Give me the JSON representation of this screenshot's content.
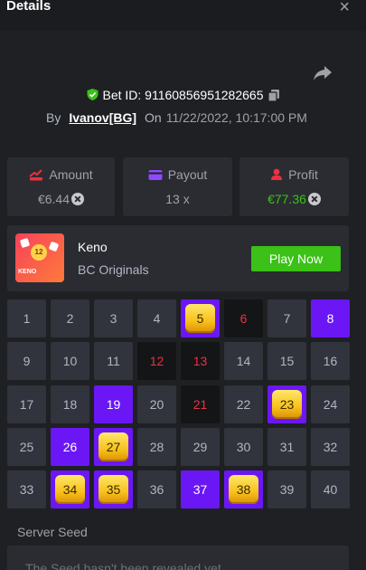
{
  "header": {
    "title": "Details",
    "close_icon": "×"
  },
  "bet": {
    "id_text": "Bet ID: 91160856951282665",
    "by_label": "By",
    "user": "Ivanov[BG]",
    "on_label": "On",
    "datetime": "11/22/2022, 10:17:00 PM"
  },
  "stats": {
    "amount": {
      "label": "Amount",
      "value": "€6.44"
    },
    "payout": {
      "label": "Payout",
      "value": "13 x"
    },
    "profit": {
      "label": "Profit",
      "value": "€77.36"
    }
  },
  "game": {
    "name": "Keno",
    "provider": "BC Originals",
    "play_button": "Play Now",
    "thumb_label": "KENO",
    "thumb_ball": "12"
  },
  "grid": {
    "cells": [
      {
        "n": "1",
        "state": "normal"
      },
      {
        "n": "2",
        "state": "normal"
      },
      {
        "n": "3",
        "state": "normal"
      },
      {
        "n": "4",
        "state": "normal"
      },
      {
        "n": "5",
        "state": "hit"
      },
      {
        "n": "6",
        "state": "miss"
      },
      {
        "n": "7",
        "state": "normal"
      },
      {
        "n": "8",
        "state": "selected"
      },
      {
        "n": "9",
        "state": "normal"
      },
      {
        "n": "10",
        "state": "normal"
      },
      {
        "n": "11",
        "state": "normal"
      },
      {
        "n": "12",
        "state": "miss"
      },
      {
        "n": "13",
        "state": "miss"
      },
      {
        "n": "14",
        "state": "normal"
      },
      {
        "n": "15",
        "state": "normal"
      },
      {
        "n": "16",
        "state": "normal"
      },
      {
        "n": "17",
        "state": "normal"
      },
      {
        "n": "18",
        "state": "normal"
      },
      {
        "n": "19",
        "state": "selected"
      },
      {
        "n": "20",
        "state": "normal"
      },
      {
        "n": "21",
        "state": "miss"
      },
      {
        "n": "22",
        "state": "normal"
      },
      {
        "n": "23",
        "state": "hit"
      },
      {
        "n": "24",
        "state": "normal"
      },
      {
        "n": "25",
        "state": "normal"
      },
      {
        "n": "26",
        "state": "selected"
      },
      {
        "n": "27",
        "state": "hit"
      },
      {
        "n": "28",
        "state": "normal"
      },
      {
        "n": "29",
        "state": "normal"
      },
      {
        "n": "30",
        "state": "normal"
      },
      {
        "n": "31",
        "state": "normal"
      },
      {
        "n": "32",
        "state": "normal"
      },
      {
        "n": "33",
        "state": "normal"
      },
      {
        "n": "34",
        "state": "hit"
      },
      {
        "n": "35",
        "state": "hit"
      },
      {
        "n": "36",
        "state": "normal"
      },
      {
        "n": "37",
        "state": "selected"
      },
      {
        "n": "38",
        "state": "hit"
      },
      {
        "n": "39",
        "state": "normal"
      },
      {
        "n": "40",
        "state": "normal"
      }
    ]
  },
  "seed": {
    "label": "Server Seed",
    "text": "The Seed hasn't been revealed yet"
  },
  "icons": {
    "close": "close-icon",
    "share": "share-icon",
    "shield": "shield-check-icon",
    "copy": "copy-icon",
    "amount": "amount-icon",
    "payout": "payout-icon",
    "profit": "profit-icon",
    "coin": "coin-icon"
  },
  "colors": {
    "accent_green": "#3bc117",
    "selected_purple": "#6b17f5",
    "miss_red": "#ed3040",
    "background": "#1e2023",
    "panel": "#2a2c31"
  }
}
